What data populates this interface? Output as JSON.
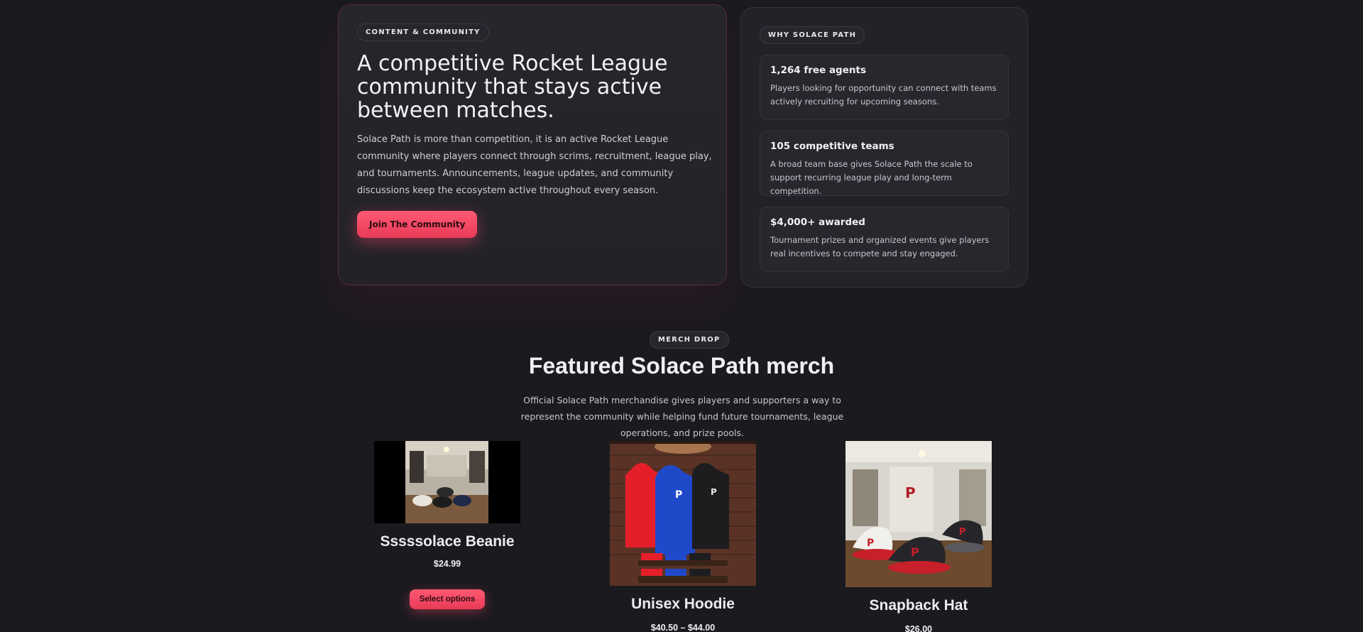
{
  "hero": {
    "badge": "CONTENT & COMMUNITY",
    "title": "A competitive Rocket League community that stays active between matches.",
    "text": "Solace Path is more than competition, it is an active Rocket League community where players connect through scrims, recruitment, league play, and tournaments. Announcements, league updates, and community discussions keep the ecosystem active throughout every season.",
    "cta": "Join The Community"
  },
  "why": {
    "badge": "WHY SOLACE PATH",
    "items": [
      {
        "title": "1,264 free agents",
        "text": "Players looking for opportunity can connect with teams actively recruiting for upcoming seasons."
      },
      {
        "title": "105 competitive teams",
        "text": "A broad team base gives Solace Path the scale to support recurring league play and long-term competition."
      },
      {
        "title": "$4,000+ awarded",
        "text": "Tournament prizes and organized events give players real incentives to compete and stay engaged."
      }
    ]
  },
  "merch": {
    "badge": "MERCH DROP",
    "title": "Featured Solace Path merch",
    "text": "Official Solace Path merchandise gives players and supporters a way to represent the community while helping fund future tournaments, league operations, and prize pools.",
    "products": [
      {
        "name": "Sssssolace Beanie",
        "price": "$24.99",
        "button": "Select options"
      },
      {
        "name": "Unisex Hoodie",
        "price": "$40.50 – $44.00"
      },
      {
        "name": "Snapback Hat",
        "price": "$26.00"
      }
    ]
  },
  "colors": {
    "background": "#1a1a1f",
    "accent": "#ff4d6a",
    "card": "#222228"
  }
}
